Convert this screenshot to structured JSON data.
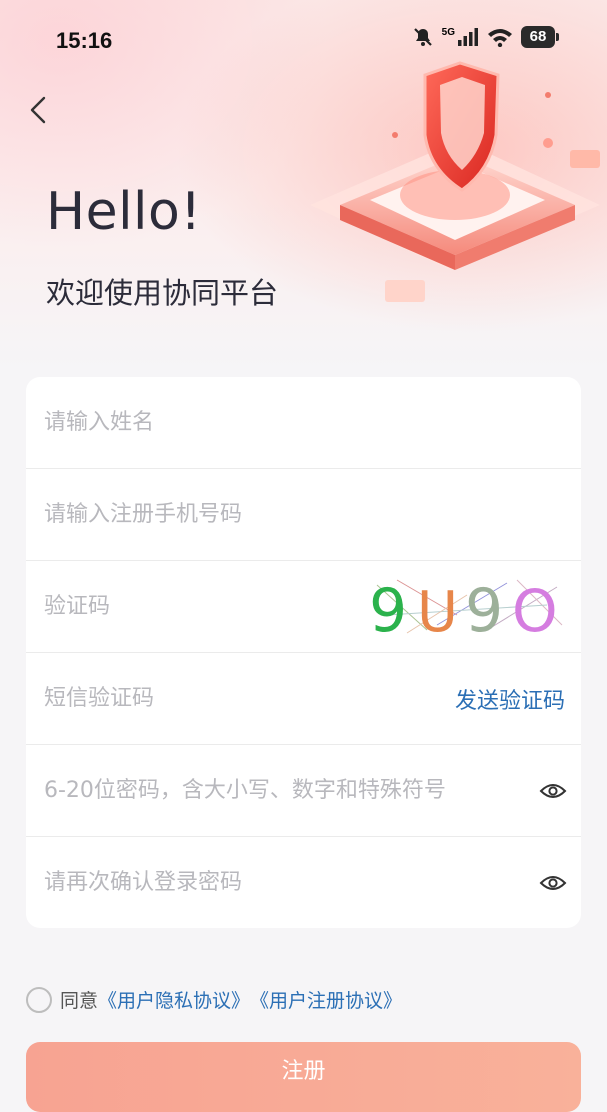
{
  "status_bar": {
    "time": "15:16",
    "network": "5G",
    "battery": "68"
  },
  "header": {
    "title": "Hello!",
    "subtitle": "欢迎使用协同平台"
  },
  "form": {
    "name_placeholder": "请输入姓名",
    "phone_placeholder": "请输入注册手机号码",
    "captcha_placeholder": "验证码",
    "captcha_text": "9U9O",
    "sms_placeholder": "短信验证码",
    "send_code_label": "发送验证码",
    "password_placeholder": "6-20位密码，含大小写、数字和特殊符号",
    "confirm_placeholder": "请再次确认登录密码"
  },
  "agreement": {
    "prefix": "同意",
    "privacy_link": "《用户隐私协议》",
    "register_link": "《用户注册协议》"
  },
  "register_label": "注册",
  "icons": {
    "back": "chevron-left-icon",
    "mute": "bell-off-icon",
    "signal": "signal-icon",
    "wifi": "wifi-icon",
    "eye": "eye-icon"
  },
  "colors": {
    "link": "#2b6fb5",
    "button": "#f7a392",
    "shield": "#ef3b36"
  }
}
